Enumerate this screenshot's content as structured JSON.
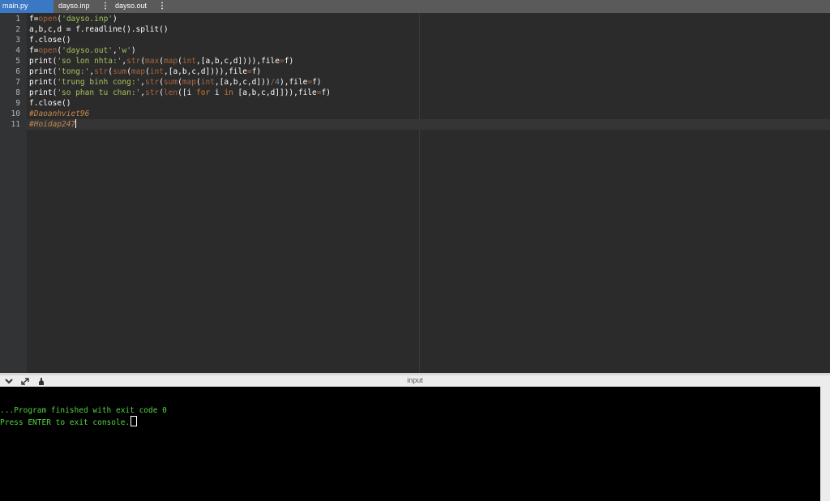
{
  "tabs": [
    {
      "label": "main.py",
      "active": true
    },
    {
      "label": "dayso.inp",
      "active": false
    },
    {
      "label": "dayso.out",
      "active": false
    }
  ],
  "tab_menu_glyph": "⋮",
  "editor": {
    "lines": [
      {
        "n": "1",
        "tokens": [
          [
            "v",
            "f"
          ],
          [
            "pun",
            "="
          ],
          [
            "fn",
            "open"
          ],
          [
            "pun",
            "("
          ],
          [
            "str",
            "'dayso.inp'"
          ],
          [
            "pun",
            ")"
          ]
        ]
      },
      {
        "n": "2",
        "tokens": [
          [
            "v",
            "a,b,c,d = f.readline().split()"
          ]
        ]
      },
      {
        "n": "3",
        "tokens": [
          [
            "v",
            "f.close()"
          ]
        ]
      },
      {
        "n": "4",
        "tokens": [
          [
            "v",
            "f"
          ],
          [
            "pun",
            "="
          ],
          [
            "fn",
            "open"
          ],
          [
            "pun",
            "("
          ],
          [
            "str",
            "'dayso.out'"
          ],
          [
            "pun",
            ","
          ],
          [
            "str",
            "'w'"
          ],
          [
            "pun",
            ")"
          ]
        ]
      },
      {
        "n": "5",
        "tokens": [
          [
            "v",
            "print("
          ],
          [
            "str",
            "'so lon nhta:'"
          ],
          [
            "pun",
            ","
          ],
          [
            "fn",
            "str"
          ],
          [
            "pun",
            "("
          ],
          [
            "fn",
            "max"
          ],
          [
            "pun",
            "("
          ],
          [
            "fn",
            "map"
          ],
          [
            "pun",
            "("
          ],
          [
            "fn",
            "int"
          ],
          [
            "pun",
            ",[a,b,c,d]))),file"
          ],
          [
            "fn",
            "="
          ],
          [
            "pun",
            "f)"
          ]
        ]
      },
      {
        "n": "6",
        "tokens": [
          [
            "v",
            "print("
          ],
          [
            "str",
            "'tong:'"
          ],
          [
            "pun",
            ","
          ],
          [
            "fn",
            "str"
          ],
          [
            "pun",
            "("
          ],
          [
            "fn",
            "sum"
          ],
          [
            "pun",
            "("
          ],
          [
            "fn",
            "map"
          ],
          [
            "pun",
            "("
          ],
          [
            "fn",
            "int"
          ],
          [
            "pun",
            ",[a,b,c,d]))),file"
          ],
          [
            "fn",
            "="
          ],
          [
            "pun",
            "f)"
          ]
        ]
      },
      {
        "n": "7",
        "tokens": [
          [
            "v",
            "print("
          ],
          [
            "str",
            "'trung binh cong:'"
          ],
          [
            "pun",
            ","
          ],
          [
            "fn",
            "str"
          ],
          [
            "pun",
            "("
          ],
          [
            "fn",
            "sum"
          ],
          [
            "pun",
            "("
          ],
          [
            "fn",
            "map"
          ],
          [
            "pun",
            "("
          ],
          [
            "fn",
            "int"
          ],
          [
            "pun",
            ",[a,b,c,d]))"
          ],
          [
            "fn",
            "/"
          ],
          [
            "num",
            "4"
          ],
          [
            "pun",
            "),file"
          ],
          [
            "fn",
            "="
          ],
          [
            "pun",
            "f)"
          ]
        ]
      },
      {
        "n": "8",
        "tokens": [
          [
            "v",
            "print("
          ],
          [
            "str",
            "'so phan tu chan:'"
          ],
          [
            "pun",
            ","
          ],
          [
            "fn",
            "str"
          ],
          [
            "pun",
            "("
          ],
          [
            "fn",
            "len"
          ],
          [
            "pun",
            "([i "
          ],
          [
            "kw",
            "for"
          ],
          [
            "pun",
            " i "
          ],
          [
            "kw",
            "in"
          ],
          [
            "pun",
            " [a,b,c,d]])),file"
          ],
          [
            "fn",
            "="
          ],
          [
            "pun",
            "f)"
          ]
        ]
      },
      {
        "n": "9",
        "tokens": [
          [
            "v",
            "f.close()"
          ]
        ]
      },
      {
        "n": "10",
        "tokens": [
          [
            "cm",
            "#Daoanhviet96"
          ]
        ]
      },
      {
        "n": "11",
        "tokens": [
          [
            "cm",
            "#Hoidap247"
          ]
        ]
      }
    ]
  },
  "console": {
    "title": "input",
    "lines": [
      "...Program finished with exit code 0",
      "Press ENTER to exit console."
    ]
  },
  "colors": {
    "active_tab": "#3b78c4",
    "editor_bg": "#2b2b2b",
    "string": "#a5c25c",
    "builtin": "#a8663c",
    "keyword": "#cc7832",
    "console_text": "#52d33f"
  }
}
